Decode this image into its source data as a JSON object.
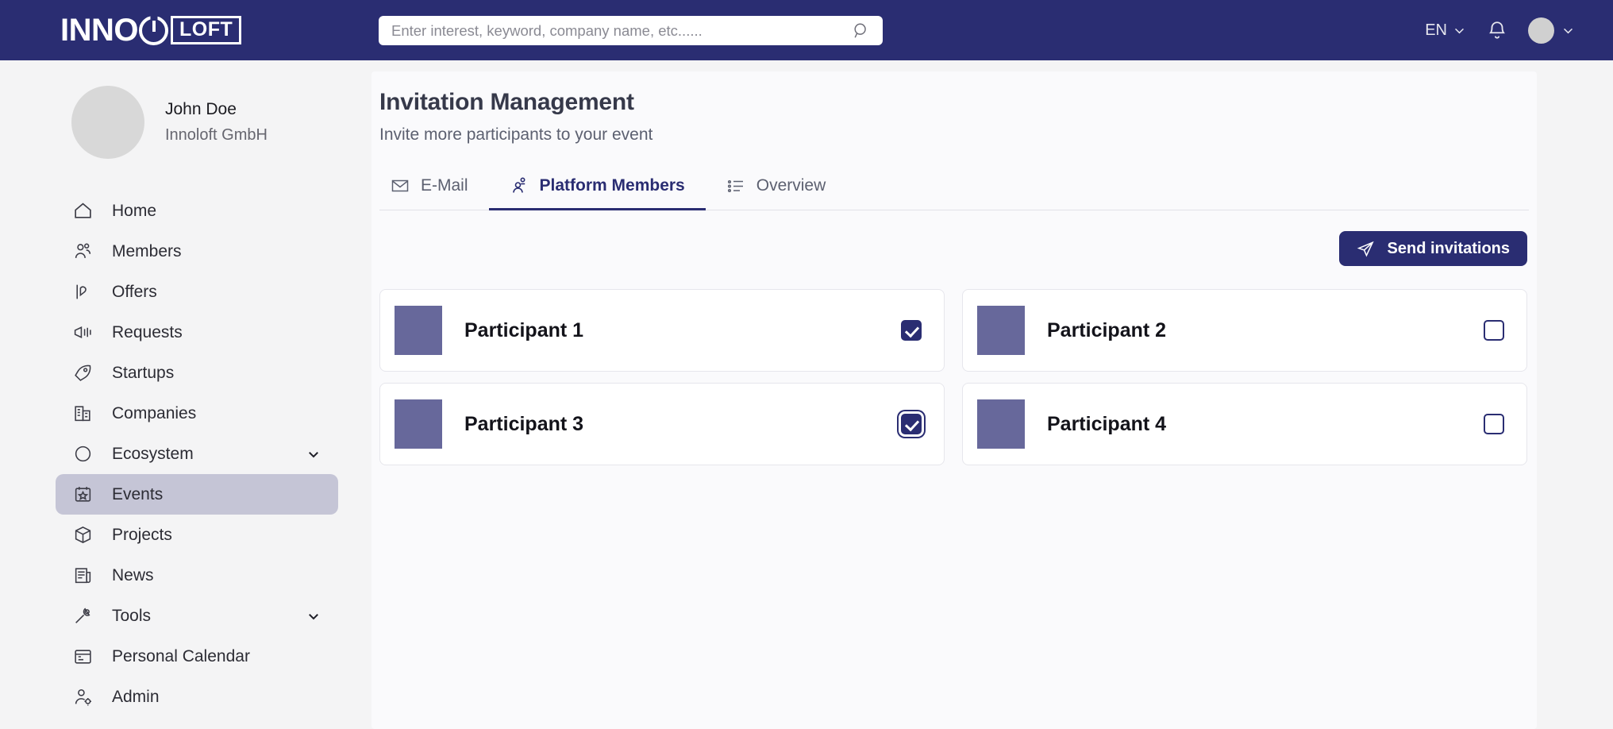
{
  "brand": {
    "inno": "INNO",
    "loft": "LOFT",
    "power_icon": "power-icon"
  },
  "search": {
    "placeholder": "Enter interest, keyword, company name, etc......",
    "value": "",
    "icon": "search-icon"
  },
  "header": {
    "language": "EN",
    "language_chevron": "chevron-down-icon",
    "notifications_icon": "bell-icon",
    "avatar": "avatar",
    "avatar_chevron": "chevron-down-icon",
    "background_color": "#2A2D72"
  },
  "profile": {
    "name": "John Doe",
    "organization": "Innoloft GmbH",
    "avatar": "profile-avatar"
  },
  "sidebar": {
    "items": [
      {
        "label": "Home",
        "icon": "home-icon",
        "active": false,
        "expandable": false
      },
      {
        "label": "Members",
        "icon": "members-icon",
        "active": false,
        "expandable": false
      },
      {
        "label": "Offers",
        "icon": "offers-icon",
        "active": false,
        "expandable": false
      },
      {
        "label": "Requests",
        "icon": "requests-icon",
        "active": false,
        "expandable": false
      },
      {
        "label": "Startups",
        "icon": "startups-icon",
        "active": false,
        "expandable": false
      },
      {
        "label": "Companies",
        "icon": "companies-icon",
        "active": false,
        "expandable": false
      },
      {
        "label": "Ecosystem",
        "icon": "ecosystem-icon",
        "active": false,
        "expandable": true
      },
      {
        "label": "Events",
        "icon": "events-icon",
        "active": true,
        "expandable": false
      },
      {
        "label": "Projects",
        "icon": "projects-icon",
        "active": false,
        "expandable": false
      },
      {
        "label": "News",
        "icon": "news-icon",
        "active": false,
        "expandable": false
      },
      {
        "label": "Tools",
        "icon": "tools-icon",
        "active": false,
        "expandable": true
      },
      {
        "label": "Personal Calendar",
        "icon": "calendar-icon",
        "active": false,
        "expandable": false
      },
      {
        "label": "Admin",
        "icon": "admin-icon",
        "active": false,
        "expandable": false
      }
    ],
    "active_background": "#C5C5D6"
  },
  "main": {
    "title": "Invitation Management",
    "subtitle": "Invite more participants to your event",
    "tabs": [
      {
        "label": "E-Mail",
        "icon": "envelope-icon",
        "active": false
      },
      {
        "label": "Platform Members",
        "icon": "members-icon",
        "active": true
      },
      {
        "label": "Overview",
        "icon": "list-icon",
        "active": false
      }
    ],
    "send_button": {
      "label": "Send invitations",
      "icon": "paper-plane-icon",
      "color": "#2A2D72"
    },
    "participants": [
      {
        "name": "Participant 1",
        "checked": true,
        "focused": false,
        "thumbnail_color": "#67689B"
      },
      {
        "name": "Participant 2",
        "checked": false,
        "focused": false,
        "thumbnail_color": "#67689B"
      },
      {
        "name": "Participant 3",
        "checked": true,
        "focused": true,
        "thumbnail_color": "#67689B"
      },
      {
        "name": "Participant 4",
        "checked": false,
        "focused": false,
        "thumbnail_color": "#67689B"
      }
    ]
  }
}
